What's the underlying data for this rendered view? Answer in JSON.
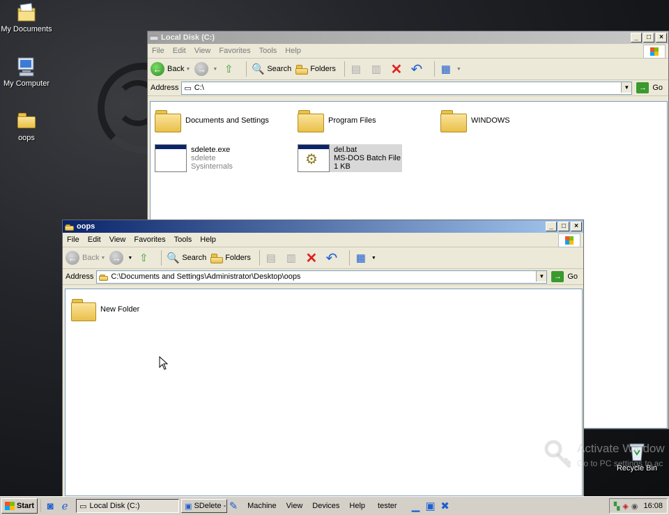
{
  "desktop": {
    "icons": [
      {
        "label": "My Documents",
        "icon": "my-documents-icon"
      },
      {
        "label": "My Computer",
        "icon": "my-computer-icon"
      },
      {
        "label": "oops",
        "icon": "folder-icon"
      },
      {
        "label": "Recycle Bin",
        "icon": "recycle-bin-icon"
      }
    ],
    "watermark": {
      "line1": "Activate Window",
      "line2": "Go to PC settings to ac"
    }
  },
  "back_window": {
    "title": "Local Disk (C:)",
    "menu": [
      "File",
      "Edit",
      "View",
      "Favorites",
      "Tools",
      "Help"
    ],
    "toolbar": {
      "back": "Back",
      "search": "Search",
      "folders": "Folders"
    },
    "address_label": "Address",
    "address_value": "C:\\",
    "go_label": "Go",
    "items": [
      {
        "name": "Documents and Settings",
        "type": "folder"
      },
      {
        "name": "Program Files",
        "type": "folder"
      },
      {
        "name": "WINDOWS",
        "type": "folder"
      },
      {
        "name": "sdelete.exe",
        "line2": "sdelete",
        "line3": "Sysinternals",
        "type": "exe"
      },
      {
        "name": "del.bat",
        "line2": "MS-DOS Batch File",
        "line3": "1 KB",
        "type": "bat"
      }
    ]
  },
  "front_window": {
    "title": "oops",
    "menu": [
      "File",
      "Edit",
      "View",
      "Favorites",
      "Tools",
      "Help"
    ],
    "toolbar": {
      "back": "Back",
      "search": "Search",
      "folders": "Folders"
    },
    "address_label": "Address",
    "address_value": "C:\\Documents and Settings\\Administrator\\Desktop\\oops",
    "go_label": "Go",
    "items": [
      {
        "name": "New Folder",
        "type": "folder"
      }
    ]
  },
  "taskbar": {
    "start": "Start",
    "tasks": [
      "Local Disk (C:)",
      "SDelete -"
    ],
    "vm_menu": [
      "Machine",
      "View",
      "Devices",
      "Help"
    ],
    "vm_name": "tester",
    "clock": "16:08"
  },
  "colors": {
    "active_title_start": "#0a246a",
    "active_title_end": "#a6caf0",
    "delete_red": "#e02020",
    "go_green": "#3a9a2e"
  }
}
